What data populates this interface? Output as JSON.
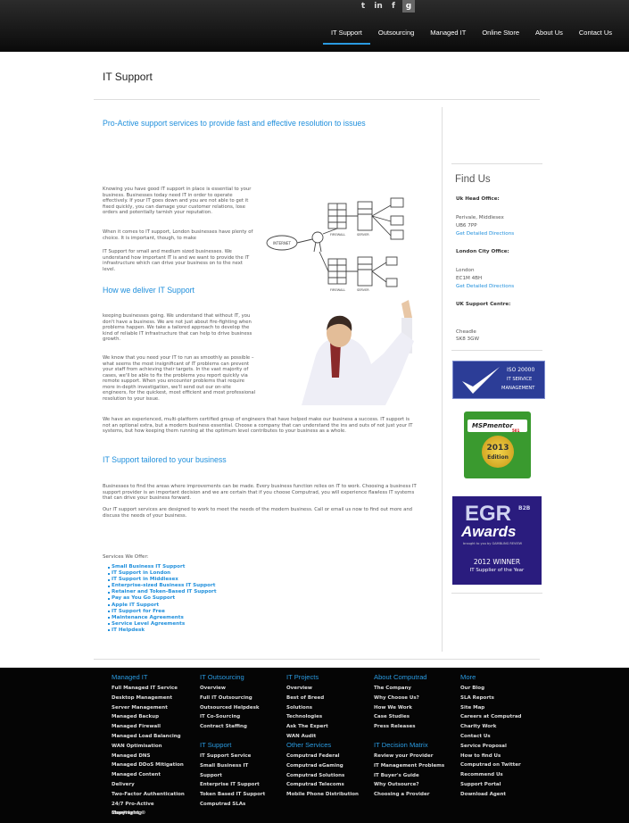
{
  "social": {
    "twitter": "t",
    "linkedin": "in",
    "facebook": "f",
    "googleplus": "g"
  },
  "nav": [
    "IT Support",
    "Outsourcing",
    "Managed IT",
    "Online Store",
    "About Us",
    "Contact Us"
  ],
  "page_title": "IT Support",
  "headings": {
    "h1": "Pro-Active support services to provide fast and effective resolution to issues",
    "h2": "How we deliver IT Support",
    "h3": "IT Support tailored to your business"
  },
  "paragraphs": {
    "p1": "Knowing you have good IT support in place is essential to your business. Businesses today need IT in order to operate effectively. If your IT goes down and you are not able to get it fixed quickly, you can damage your customer relations, lose orders and potentially tarnish your reputation.",
    "p2": "When it comes to IT support, London businesses have plenty of choice. It is important, though, to make",
    "p3": "IT Support for small and medium sized businesses. We understand how important IT is and we want to provide the IT infrastructure which can drive your business on to the next level.",
    "p4": "keeping businesses going. We understand that without IT, you don't have a business. We are not just about fire-fighting when problems happen. We take a tailored approach to develop the kind of reliable IT infrastructure that can help to drive business growth.",
    "p5": "We know that you need your IT to run as smoothly as possible – what seems the most insignificant of IT problems can prevent your staff from achieving their targets. In the vast majority of cases, we'll be able to fix the problems you report quickly via remote support. When you encounter problems that require more in-depth investigation, we'll send out our on-site engineers, for the quickest, most efficient and most professional resolution to your issue.",
    "p6": "We have an experienced, multi-platform certified group of engineers that have helped make our business a success. IT support is not an optional extra, but a modern business essential. Choose a company that can understand the ins and outs of not just your IT systems, but how keeping them running at the optimum level contributes to your business as a whole.",
    "p7": "Businesses to find the areas where improvements can be made. Every business function relies on IT to work. Choosing a business IT support provider is an important decision and we are certain that if you choose Computrad, you will experience flawless IT systems that can drive your business forward.",
    "p8": "Our IT support services are designed to work to meet the needs of the modern business. Call or email us now to find out more and discuss the needs of your business."
  },
  "illustration": {
    "internet": "INTERNET",
    "firewall": "FIREWALL",
    "server": "SERVER"
  },
  "services_title": "Services We Offer:",
  "services": [
    "Small Business IT Support",
    "IT Support in London",
    "IT Support in Middlesex",
    "Enterprise-sized Business IT Support",
    "Retainer and Token-Based IT Support",
    "Pay as You Go Support",
    "Apple IT Support",
    "IT Support for Free",
    "Maintenance Agreements",
    "Service Level Agreements",
    "IT Helpdesk"
  ],
  "sidebar": {
    "find_us": "Find Us",
    "uk_head_label": "Uk Head Office:",
    "uk_head_addr": [
      "Perivale, Middlesex",
      "UB6 7PP"
    ],
    "directions": "Get Detailed Directions",
    "london_label": "London City Office:",
    "london_addr": [
      "London",
      "EC1M 4BH"
    ],
    "support_label": "UK Support Centre:",
    "support_addr": [
      "Cheadle",
      "SK8 3GW"
    ]
  },
  "badges": {
    "iso_line1": "ISO 20000",
    "iso_line2": "IT SERVICE",
    "iso_line3": "MANAGEMENT",
    "msp_brand": "MSPmentor",
    "msp_num": "501",
    "msp_year": "2013",
    "msp_edition": "Edition",
    "egr_logo": "EGR",
    "egr_b2b": "B2B",
    "egr_awards": "Awards",
    "egr_brought": "brought to you by GAMBLING REVIEW",
    "egr_year": "2012 WINNER",
    "egr_title": "IT Supplier of the Year"
  },
  "footer": {
    "columns": [
      {
        "title": "Managed IT",
        "links": [
          "Full Managed IT Service",
          "Desktop Management",
          "Server Management",
          "Managed Backup",
          "Managed Firewall",
          "Managed Load Balancing",
          "WAN Optimisation",
          "Managed DNS",
          "Managed DDoS Mitigation",
          "Managed Content",
          "Delivery",
          "Two-Factor Authentication",
          "24/7 Pro-Active",
          "Monitoring"
        ]
      },
      {
        "title": "IT Outsourcing",
        "links": [
          "Overview",
          "Full IT Outsourcing",
          "Outsourced Helpdesk",
          "IT Co-Sourcing",
          "Contract Staffing"
        ]
      },
      {
        "title": "IT Support",
        "links": [
          "IT Support Service",
          "Small Business IT",
          "Support",
          "Enterprise IT Support",
          "Token Based IT Support",
          "Computrad SLAs"
        ]
      },
      {
        "title": "IT Projects",
        "links": [
          "Overview",
          "Best of Breed",
          "Solutions",
          "Technologies",
          "Ask The Expert",
          "WAN Audit"
        ]
      },
      {
        "title": "Other Services",
        "links": [
          "Computrad Federal",
          "Computrad eGaming",
          "Computrad Solutions",
          "Computrad Telecoms",
          "Mobile Phone Distribution"
        ]
      },
      {
        "title": "About Computrad",
        "links": [
          "The Company",
          "Why Choose Us?",
          "How We Work",
          "Case Studies",
          "Press Releases"
        ]
      },
      {
        "title": "IT Decision Matrix",
        "links": [
          "Review your Provider",
          "IT Management Problems",
          "IT Buyer's Guide",
          "Why Outsource?",
          "Choosing a Provider"
        ]
      },
      {
        "title": "More",
        "links": [
          "Our Blog",
          "SLA Reports",
          "Site Map",
          "Careers at Computrad",
          "Charity Work",
          "Contact Us",
          "Service Proposal",
          "How to find Us",
          "Computrad on Twitter",
          "Recommend Us",
          "Support Portal",
          "Download Agent"
        ]
      }
    ],
    "copyright": "Copyright ©"
  }
}
